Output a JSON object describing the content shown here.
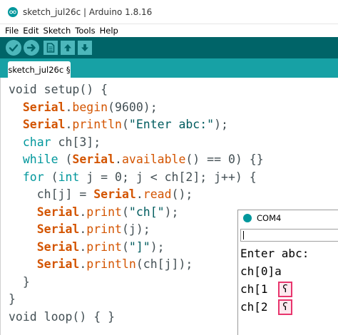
{
  "window": {
    "title": "sketch_jul26c | Arduino 1.8.16",
    "icon": "arduino-logo-icon"
  },
  "menu": {
    "items": [
      "File",
      "Edit",
      "Sketch",
      "Tools",
      "Help"
    ]
  },
  "toolbar": {
    "buttons": [
      "verify-icon",
      "upload-icon",
      "new-icon",
      "open-icon",
      "save-icon"
    ],
    "color": "#006468",
    "button_color": "#4db7bb"
  },
  "tabs": {
    "active": "sketch_jul26c §"
  },
  "code": {
    "lines": [
      [
        {
          "t": "txt",
          "s": "void setup() {"
        }
      ],
      [
        {
          "t": "txt",
          "s": "  "
        },
        {
          "t": "obj",
          "s": "Serial"
        },
        {
          "t": "txt",
          "s": "."
        },
        {
          "t": "fn",
          "s": "begin"
        },
        {
          "t": "txt",
          "s": "(9600);"
        }
      ],
      [
        {
          "t": "txt",
          "s": "  "
        },
        {
          "t": "obj",
          "s": "Serial"
        },
        {
          "t": "txt",
          "s": "."
        },
        {
          "t": "fn",
          "s": "println"
        },
        {
          "t": "txt",
          "s": "("
        },
        {
          "t": "str",
          "s": "\"Enter abc:\""
        },
        {
          "t": "txt",
          "s": ");"
        }
      ],
      [
        {
          "t": "txt",
          "s": "  "
        },
        {
          "t": "kw",
          "s": "char"
        },
        {
          "t": "txt",
          "s": " ch[3];"
        }
      ],
      [
        {
          "t": "txt",
          "s": "  "
        },
        {
          "t": "kw",
          "s": "while"
        },
        {
          "t": "txt",
          "s": " ("
        },
        {
          "t": "obj",
          "s": "Serial"
        },
        {
          "t": "txt",
          "s": "."
        },
        {
          "t": "fn",
          "s": "available"
        },
        {
          "t": "txt",
          "s": "() == 0) {}"
        }
      ],
      [
        {
          "t": "txt",
          "s": "  "
        },
        {
          "t": "kw",
          "s": "for"
        },
        {
          "t": "txt",
          "s": " ("
        },
        {
          "t": "kw",
          "s": "int"
        },
        {
          "t": "txt",
          "s": " j = 0; j < ch[2]; j++) {"
        }
      ],
      [
        {
          "t": "txt",
          "s": "    ch[j] = "
        },
        {
          "t": "obj",
          "s": "Serial"
        },
        {
          "t": "txt",
          "s": "."
        },
        {
          "t": "fn",
          "s": "read"
        },
        {
          "t": "txt",
          "s": "();"
        }
      ],
      [
        {
          "t": "txt",
          "s": "    "
        },
        {
          "t": "obj",
          "s": "Serial"
        },
        {
          "t": "txt",
          "s": "."
        },
        {
          "t": "fn",
          "s": "print"
        },
        {
          "t": "txt",
          "s": "("
        },
        {
          "t": "str",
          "s": "\"ch[\""
        },
        {
          "t": "txt",
          "s": ");"
        }
      ],
      [
        {
          "t": "txt",
          "s": "    "
        },
        {
          "t": "obj",
          "s": "Serial"
        },
        {
          "t": "txt",
          "s": "."
        },
        {
          "t": "fn",
          "s": "print"
        },
        {
          "t": "txt",
          "s": "(j);"
        }
      ],
      [
        {
          "t": "txt",
          "s": "    "
        },
        {
          "t": "obj",
          "s": "Serial"
        },
        {
          "t": "txt",
          "s": "."
        },
        {
          "t": "fn",
          "s": "print"
        },
        {
          "t": "txt",
          "s": "("
        },
        {
          "t": "str",
          "s": "\"]\""
        },
        {
          "t": "txt",
          "s": ");"
        }
      ],
      [
        {
          "t": "txt",
          "s": "    "
        },
        {
          "t": "obj",
          "s": "Serial"
        },
        {
          "t": "txt",
          "s": "."
        },
        {
          "t": "fn",
          "s": "println"
        },
        {
          "t": "txt",
          "s": "(ch[j]);"
        }
      ],
      [
        {
          "t": "txt",
          "s": "  }"
        }
      ],
      [
        {
          "t": "txt",
          "s": "}"
        }
      ],
      [
        {
          "t": "txt",
          "s": "void loop() { }"
        }
      ]
    ]
  },
  "serial_monitor": {
    "title": "COM4",
    "input_value": "",
    "output": [
      "Enter abc:",
      "ch[0]a",
      "ch[1",
      "ch[2"
    ],
    "garbage_char": "ʕ",
    "highlight_color": "#e8356d"
  }
}
